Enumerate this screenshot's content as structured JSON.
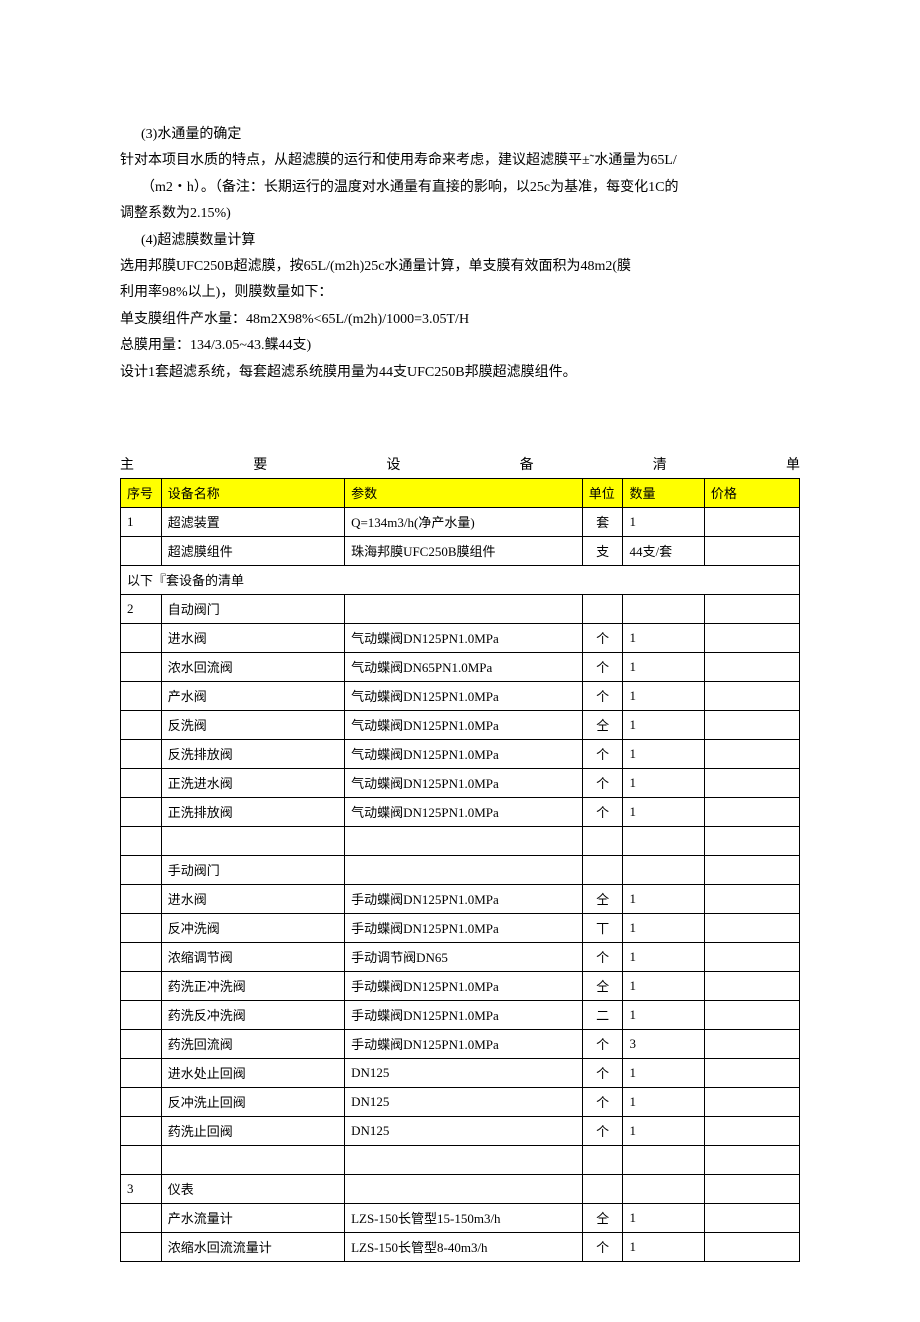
{
  "para": {
    "l1": "(3)水通量的确定",
    "l2": "针对本项目水质的特点，从超滤膜的运行和使用寿命来考虑，建议超滤膜平±˜水通量为65L/",
    "l3": "（m2・h）。（备注：长期运行的温度对水通量有直接的影响，以25c为基准，每变化1C的",
    "l4": "调整系数为2.15%)",
    "l5": "(4)超滤膜数量计算",
    "l6": "选用邦膜UFC250B超滤膜，按65L/(m2h)25c水通量计算，单支膜有效面积为48m2(膜",
    "l7": "利用率98%以上)，则膜数量如下：",
    "l8": "单支膜组件产水量：48m2X98%<65L/(m2h)/1000=3.05T/H",
    "l9": "总膜用量：134/3.05~43.鲽44支)",
    "l10": "设计1套超滤系统，每套超滤系统膜用量为44支UFC250B邦膜超滤膜组件。"
  },
  "title_spread": [
    "主",
    "要",
    "设",
    "备",
    "清",
    "单"
  ],
  "headers": {
    "idx": "序号",
    "name": "设备名称",
    "param": "参数",
    "unit": "单位",
    "qty": "数量",
    "price": "价格"
  },
  "rows": [
    {
      "idx": "1",
      "name": "超滤装置",
      "param": "Q=134m3/h(净产水量)",
      "unit": "套",
      "qty": "1",
      "price": ""
    },
    {
      "idx": "",
      "name": "超滤膜组件",
      "param": "珠海邦膜UFC250B膜组件",
      "unit": "支",
      "qty": "44支/套",
      "price": ""
    },
    {
      "section": "以下『套设备的清单"
    },
    {
      "idx": "2",
      "name": "自动阀门",
      "param": "",
      "unit": "",
      "qty": "",
      "price": ""
    },
    {
      "idx": "",
      "name": "进水阀",
      "param": "气动蝶阀DN125PN1.0MPa",
      "unit": "个",
      "qty": "1",
      "price": ""
    },
    {
      "idx": "",
      "name": "浓水回流阀",
      "param": "气动蝶阀DN65PN1.0MPa",
      "unit": "个",
      "qty": "1",
      "price": ""
    },
    {
      "idx": "",
      "name": "产水阀",
      "param": "气动蝶阀DN125PN1.0MPa",
      "unit": "个",
      "qty": "1",
      "price": ""
    },
    {
      "idx": "",
      "name": "反洗阀",
      "param": "气动蝶阀DN125PN1.0MPa",
      "unit": "仝",
      "qty": "1",
      "price": ""
    },
    {
      "idx": "",
      "name": "反洗排放阀",
      "param": "气动蝶阀DN125PN1.0MPa",
      "unit": "个",
      "qty": "1",
      "price": ""
    },
    {
      "idx": "",
      "name": "正洗进水阀",
      "param": "气动蝶阀DN125PN1.0MPa",
      "unit": "个",
      "qty": "1",
      "price": ""
    },
    {
      "idx": "",
      "name": "正洗排放阀",
      "param": "气动蝶阀DN125PN1.0MPa",
      "unit": "个",
      "qty": "1",
      "price": ""
    },
    {
      "blank": true
    },
    {
      "idx": "",
      "name": "手动阀门",
      "param": "",
      "unit": "",
      "qty": "",
      "price": ""
    },
    {
      "idx": "",
      "name": "进水阀",
      "param": "手动蝶阀DN125PN1.0MPa",
      "unit": "仝",
      "qty": "1",
      "price": ""
    },
    {
      "idx": "",
      "name": "反冲洗阀",
      "param": "手动蝶阀DN125PN1.0MPa",
      "unit": "丅",
      "qty": "1",
      "price": ""
    },
    {
      "idx": "",
      "name": "浓缩调节阀",
      "param": "手动调节阀DN65",
      "unit": "个",
      "qty": "1",
      "price": ""
    },
    {
      "idx": "",
      "name": "药洗正冲洗阀",
      "param": "手动蝶阀DN125PN1.0MPa",
      "unit": "仝",
      "qty": "1",
      "price": ""
    },
    {
      "idx": "",
      "name": "药洗反冲洗阀",
      "param": "手动蝶阀DN125PN1.0MPa",
      "unit": "二",
      "qty": "1",
      "price": ""
    },
    {
      "idx": "",
      "name": "药洗回流阀",
      "param": "手动蝶阀DN125PN1.0MPa",
      "unit": "个",
      "qty": "3",
      "price": ""
    },
    {
      "idx": "",
      "name": "进水处止回阀",
      "param": "DN125",
      "unit": "个",
      "qty": "1",
      "price": ""
    },
    {
      "idx": "",
      "name": "反冲洗止回阀",
      "param": "DN125",
      "unit": "个",
      "qty": "1",
      "price": ""
    },
    {
      "idx": "",
      "name": "药洗止回阀",
      "param": "DN125",
      "unit": "个",
      "qty": "1",
      "price": ""
    },
    {
      "blank": true
    },
    {
      "idx": "3",
      "name": "仪表",
      "param": "",
      "unit": "",
      "qty": "",
      "price": ""
    },
    {
      "idx": "",
      "name": "产水流量计",
      "param": "LZS-150长管型15-150m3/h",
      "unit": "仝",
      "qty": "1",
      "price": ""
    },
    {
      "idx": "",
      "name": "浓缩水回流流量计",
      "param": "LZS-150长管型8-40m3/h",
      "unit": "个",
      "qty": "1",
      "price": ""
    }
  ]
}
